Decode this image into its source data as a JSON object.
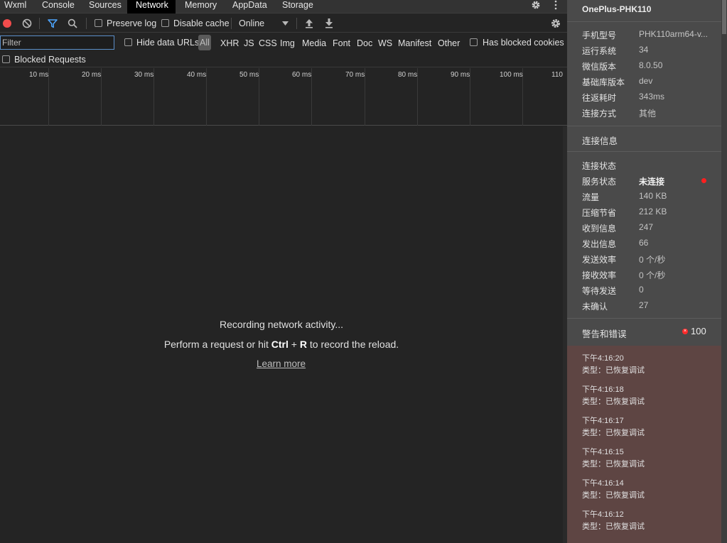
{
  "tabs": [
    {
      "label": "Wxml"
    },
    {
      "label": "Console"
    },
    {
      "label": "Sources"
    },
    {
      "label": "Network"
    },
    {
      "label": "Memory"
    },
    {
      "label": "AppData"
    },
    {
      "label": "Storage"
    }
  ],
  "active_tab": "Network",
  "toolbar": {
    "preserve_log": "Preserve log",
    "disable_cache": "Disable cache",
    "throttling": "Online"
  },
  "filter": {
    "placeholder": "Filter",
    "hide_data_urls": "Hide data URLs",
    "types": [
      "All",
      "XHR",
      "JS",
      "CSS",
      "Img",
      "Media",
      "Font",
      "Doc",
      "WS",
      "Manifest",
      "Other"
    ],
    "selected_type": "All",
    "has_blocked_cookies": "Has blocked cookies",
    "blocked_requests": "Blocked Requests"
  },
  "timeline": {
    "ticks": [
      "10 ms",
      "20 ms",
      "30 ms",
      "40 ms",
      "50 ms",
      "60 ms",
      "70 ms",
      "80 ms",
      "90 ms",
      "100 ms",
      "110"
    ]
  },
  "empty_state": {
    "line1": "Recording network activity...",
    "line2_prefix": "Perform a request or hit ",
    "key_ctrl": "Ctrl",
    "plus": " + ",
    "key_r": "R",
    "line2_suffix": " to record the reload.",
    "learn_more": "Learn more"
  },
  "device": {
    "name": "OnePlus-PHK110",
    "info": [
      {
        "key": "手机型号",
        "value": "PHK110arm64-v..."
      },
      {
        "key": "运行系统",
        "value": "34"
      },
      {
        "key": "微信版本",
        "value": "8.0.50"
      },
      {
        "key": "基础库版本",
        "value": "dev"
      },
      {
        "key": "往返耗时",
        "value": "343ms"
      },
      {
        "key": "连接方式",
        "value": "其他"
      }
    ]
  },
  "connection": {
    "section_title": "连接信息",
    "status_title": "连接状态",
    "rows": [
      {
        "key": "服务状态",
        "value": "未连接"
      },
      {
        "key": "流量",
        "value": "140 KB"
      },
      {
        "key": "压缩节省",
        "value": "212 KB"
      },
      {
        "key": "收到信息",
        "value": "247"
      },
      {
        "key": "发出信息",
        "value": "66"
      },
      {
        "key": "发送效率",
        "value": "0 个/秒"
      },
      {
        "key": "接收效率",
        "value": "0 个/秒"
      },
      {
        "key": "等待发送",
        "value": "0"
      },
      {
        "key": "未确认",
        "value": "27"
      }
    ],
    "status_color": "#ff1f1f"
  },
  "warnings": {
    "title": "警告和错误",
    "count": "100",
    "badge_symbol": "×",
    "logs": [
      {
        "time": "下午4:16:20",
        "type": "类型：已恢复调试"
      },
      {
        "time": "下午4:16:18",
        "type": "类型：已恢复调试"
      },
      {
        "time": "下午4:16:17",
        "type": "类型：已恢复调试"
      },
      {
        "time": "下午4:16:15",
        "type": "类型：已恢复调试"
      },
      {
        "time": "下午4:16:14",
        "type": "类型：已恢复调试"
      },
      {
        "time": "下午4:16:12",
        "type": "类型：已恢复调试"
      }
    ]
  }
}
